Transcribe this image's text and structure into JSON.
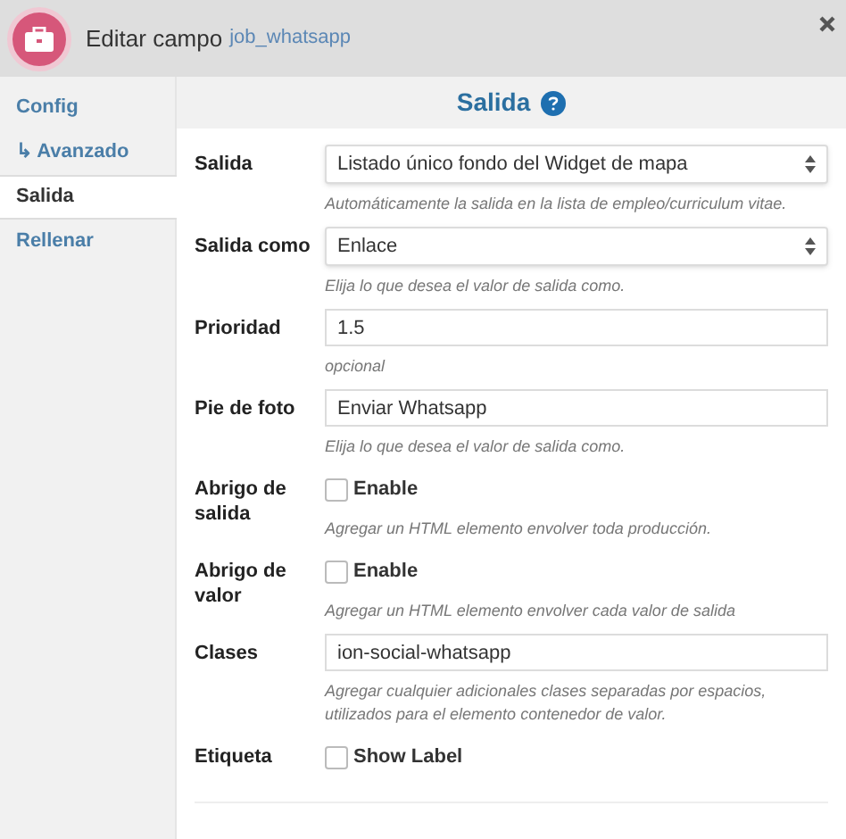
{
  "header": {
    "title": "Editar campo",
    "field_name": "job_whatsapp"
  },
  "sidebar": {
    "items": [
      {
        "label": "Config",
        "selected": false
      },
      {
        "label": "↳ Avanzado",
        "selected": false
      },
      {
        "label": "Salida",
        "selected": true
      },
      {
        "label": "Rellenar",
        "selected": false
      }
    ]
  },
  "section": {
    "title": "Salida"
  },
  "fields": [
    {
      "kind": "select",
      "label": "Salida",
      "value": "Listado único fondo del Widget de mapa",
      "help": "Automáticamente la salida en la lista de empleo/curriculum vitae."
    },
    {
      "kind": "select",
      "label": "Salida como",
      "value": "Enlace",
      "help": "Elija lo que desea el valor de salida como."
    },
    {
      "kind": "text",
      "label": "Prioridad",
      "value": "1.5",
      "help": "opcional"
    },
    {
      "kind": "text",
      "label": "Pie de foto",
      "value": "Enviar Whatsapp",
      "help": "Elija lo que desea el valor de salida como."
    },
    {
      "kind": "checkbox",
      "label": "Abrigo de salida",
      "value": "Enable",
      "checked": false,
      "help": "Agregar un HTML elemento envolver toda producción."
    },
    {
      "kind": "checkbox",
      "label": "Abrigo de valor",
      "value": "Enable",
      "checked": false,
      "help": "Agregar un HTML elemento envolver cada valor de salida"
    },
    {
      "kind": "text",
      "label": "Clases",
      "value": "ion-social-whatsapp",
      "help": "Agregar cualquier adicionales clases separadas por espacios, utilizados para el elemento contenedor de valor."
    },
    {
      "kind": "checkbox",
      "label": "Etiqueta",
      "value": "Show Label",
      "checked": false
    }
  ]
}
